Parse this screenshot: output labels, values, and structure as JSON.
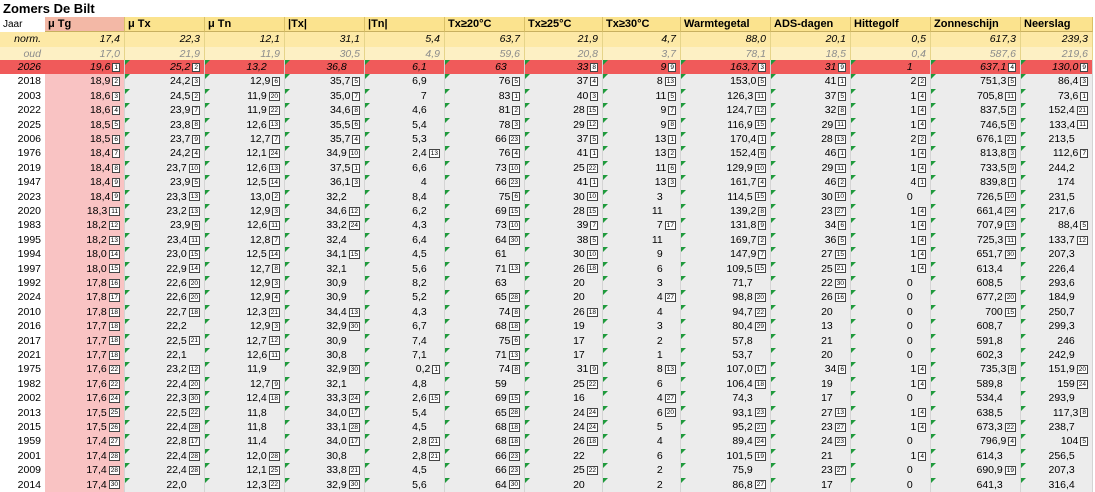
{
  "title": "Zomers De Bilt",
  "colors": {
    "header": "#fbe38e",
    "header_first": "#f3b8a6",
    "norm_row": "#fde9a6",
    "oud_row": "#fdf0c4",
    "current_row": "#f05a5a",
    "tg_column": "#f9c3c3",
    "body_band": "#ececec",
    "marker": "#1f9a3c"
  },
  "columns": [
    "Jaar",
    "μ Tg",
    "μ Tx",
    "μ Tn",
    "|Tx|",
    "|Tn|",
    "Tx≥20°C",
    "Tx≥25°C",
    "Tx≥30°C",
    "Warmtegetal",
    "ADS-dagen",
    "Hittegolf",
    "Zonneschijn",
    "Neerslag"
  ],
  "norm": {
    "label": "norm.",
    "values": [
      "17,4",
      "22,3",
      "12,1",
      "31,1",
      "5,4",
      "63,7",
      "21,9",
      "4,7",
      "88,0",
      "20,1",
      "0,5",
      "617,3",
      "239,3"
    ]
  },
  "oud": {
    "label": "oud",
    "values": [
      "17,0",
      "21,9",
      "11,9",
      "30,5",
      "4,9",
      "59,6",
      "20,8",
      "3,7",
      "78,1",
      "18,5",
      "0,4",
      "587,6",
      "219,6"
    ]
  },
  "rows": [
    {
      "y": "2026",
      "v": [
        "19,6",
        "25,2",
        "13,2",
        "36,8",
        "6,1",
        "63",
        "33",
        "9",
        "163,7",
        "31",
        "1",
        "637,1",
        "130,0"
      ],
      "r": [
        "1",
        "2",
        "",
        "",
        "",
        "",
        "8",
        "9",
        "3",
        "9",
        "",
        "4",
        "9"
      ]
    },
    {
      "y": "2018",
      "v": [
        "18,9",
        "24,2",
        "12,9",
        "35,7",
        "6,9",
        "76",
        "37",
        "8",
        "153,0",
        "41",
        "2",
        "751,3",
        "86,4"
      ],
      "r": [
        "2",
        "3",
        "6",
        "5",
        "",
        "5",
        "4",
        "13",
        "5",
        "1",
        "2",
        "5",
        "3"
      ]
    },
    {
      "y": "2003",
      "v": [
        "18,6",
        "24,5",
        "11,9",
        "35,0",
        "7",
        "83",
        "40",
        "11",
        "126,3",
        "37",
        "1",
        "705,8",
        "73,6"
      ],
      "r": [
        "3",
        "2",
        "20",
        "7",
        "",
        "1",
        "3",
        "5",
        "11",
        "5",
        "4",
        "11",
        "1"
      ]
    },
    {
      "y": "2022",
      "v": [
        "18,6",
        "23,9",
        "11,9",
        "34,6",
        "4,6",
        "81",
        "28",
        "9",
        "124,7",
        "32",
        "1",
        "837,5",
        "152,4"
      ],
      "r": [
        "4",
        "7",
        "22",
        "8",
        "",
        "2",
        "15",
        "7",
        "12",
        "8",
        "4",
        "2",
        "21"
      ]
    },
    {
      "y": "2025",
      "v": [
        "18,5",
        "23,8",
        "12,6",
        "35,5",
        "5,4",
        "78",
        "29",
        "9",
        "116,9",
        "29",
        "1",
        "746,5",
        "133,4"
      ],
      "r": [
        "5",
        "8",
        "13",
        "6",
        "",
        "3",
        "12",
        "8",
        "15",
        "11",
        "4",
        "6",
        "11"
      ]
    },
    {
      "y": "2006",
      "v": [
        "18,5",
        "23,7",
        "12,7",
        "35,7",
        "5,3",
        "66",
        "37",
        "13",
        "170,4",
        "28",
        "2",
        "676,1",
        "213,5"
      ],
      "r": [
        "6",
        "9",
        "7",
        "4",
        "",
        "23",
        "5",
        "1",
        "1",
        "13",
        "2",
        "21",
        ""
      ]
    },
    {
      "y": "1976",
      "v": [
        "18,4",
        "24,2",
        "12,1",
        "34,9",
        "2,4",
        "76",
        "41",
        "13",
        "152,4",
        "46",
        "1",
        "813,8",
        "112,6"
      ],
      "r": [
        "7",
        "4",
        "24",
        "10",
        "13",
        "4",
        "1",
        "2",
        "6",
        "1",
        "4",
        "3",
        "7"
      ]
    },
    {
      "y": "2019",
      "v": [
        "18,4",
        "23,7",
        "12,6",
        "37,5",
        "6,6",
        "73",
        "25",
        "11",
        "129,9",
        "29",
        "1",
        "733,5",
        "244,2"
      ],
      "r": [
        "8",
        "10",
        "13",
        "1",
        "",
        "10",
        "22",
        "6",
        "10",
        "11",
        "4",
        "9",
        ""
      ]
    },
    {
      "y": "1947",
      "v": [
        "18,4",
        "23,9",
        "12,5",
        "36,1",
        "4",
        "66",
        "41",
        "13",
        "161,7",
        "46",
        "4",
        "839,8",
        "174"
      ],
      "r": [
        "9",
        "5",
        "14",
        "3",
        "",
        "23",
        "1",
        "3",
        "4",
        "2",
        "1",
        "1",
        ""
      ]
    },
    {
      "y": "2023",
      "v": [
        "18,4",
        "23,3",
        "13,0",
        "32,2",
        "8,4",
        "75",
        "30",
        "3",
        "114,5",
        "30",
        "0",
        "726,5",
        "231,5"
      ],
      "r": [
        "9",
        "13",
        "2",
        "",
        "",
        "6",
        "10",
        "",
        "15",
        "10",
        "",
        "10",
        ""
      ]
    },
    {
      "y": "2020",
      "v": [
        "18,3",
        "23,2",
        "12,9",
        "34,6",
        "6,2",
        "69",
        "28",
        "11",
        "139,2",
        "23",
        "1",
        "661,4",
        "217,6"
      ],
      "r": [
        "11",
        "13",
        "3",
        "12",
        "",
        "15",
        "15",
        "",
        "8",
        "27",
        "4",
        "24",
        ""
      ]
    },
    {
      "y": "1983",
      "v": [
        "18,2",
        "23,9",
        "12,6",
        "33,2",
        "4,3",
        "73",
        "39",
        "7",
        "131,8",
        "34",
        "1",
        "707,9",
        "88,4"
      ],
      "r": [
        "12",
        "6",
        "11",
        "24",
        "",
        "10",
        "7",
        "17",
        "9",
        "6",
        "4",
        "13",
        "5"
      ]
    },
    {
      "y": "1995",
      "v": [
        "18,2",
        "23,4",
        "12,8",
        "32,4",
        "6,4",
        "64",
        "38",
        "11",
        "169,7",
        "36",
        "1",
        "725,3",
        "133,7"
      ],
      "r": [
        "13",
        "11",
        "7",
        "",
        "",
        "30",
        "5",
        "",
        "2",
        "5",
        "4",
        "11",
        "12"
      ]
    },
    {
      "y": "1994",
      "v": [
        "18,0",
        "23,0",
        "12,5",
        "34,1",
        "4,5",
        "61",
        "30",
        "9",
        "147,9",
        "27",
        "1",
        "651,7",
        "207,3"
      ],
      "r": [
        "14",
        "15",
        "14",
        "15",
        "",
        "",
        "10",
        "",
        "7",
        "15",
        "4",
        "30",
        ""
      ]
    },
    {
      "y": "1997",
      "v": [
        "18,0",
        "22,9",
        "12,7",
        "32,1",
        "5,6",
        "71",
        "26",
        "6",
        "109,5",
        "25",
        "1",
        "613,4",
        "226,4"
      ],
      "r": [
        "15",
        "14",
        "8",
        "",
        "",
        "13",
        "18",
        "",
        "15",
        "21",
        "4",
        "",
        ""
      ]
    },
    {
      "y": "1992",
      "v": [
        "17,8",
        "22,6",
        "12,9",
        "30,9",
        "8,2",
        "63",
        "20",
        "3",
        "71,7",
        "22",
        "0",
        "608,5",
        "293,6"
      ],
      "r": [
        "16",
        "20",
        "3",
        "",
        "",
        "",
        "",
        "",
        "",
        "30",
        "",
        "",
        ""
      ]
    },
    {
      "y": "2024",
      "v": [
        "17,8",
        "22,6",
        "12,9",
        "30,9",
        "5,2",
        "65",
        "20",
        "4",
        "98,8",
        "26",
        "0",
        "677,2",
        "184,9"
      ],
      "r": [
        "17",
        "20",
        "4",
        "",
        "",
        "28",
        "",
        "27",
        "20",
        "16",
        "",
        "20",
        ""
      ]
    },
    {
      "y": "2010",
      "v": [
        "17,8",
        "22,7",
        "12,3",
        "34,4",
        "4,3",
        "74",
        "26",
        "4",
        "94,7",
        "20",
        "0",
        "700",
        "250,7"
      ],
      "r": [
        "18",
        "18",
        "21",
        "13",
        "",
        "8",
        "18",
        "",
        "22",
        "",
        "",
        "15",
        ""
      ]
    },
    {
      "y": "2016",
      "v": [
        "17,7",
        "22,2",
        "12,9",
        "32,9",
        "6,7",
        "68",
        "19",
        "3",
        "80,4",
        "13",
        "0",
        "608,7",
        "299,3"
      ],
      "r": [
        "18",
        "",
        "3",
        "30",
        "",
        "18",
        "",
        "",
        "29",
        "",
        "",
        "",
        ""
      ]
    },
    {
      "y": "2017",
      "v": [
        "17,7",
        "22,5",
        "12,7",
        "30,9",
        "7,4",
        "75",
        "17",
        "2",
        "57,8",
        "21",
        "0",
        "591,8",
        "246"
      ],
      "r": [
        "18",
        "21",
        "12",
        "",
        "",
        "6",
        "",
        "",
        "",
        "",
        "",
        "",
        ""
      ]
    },
    {
      "y": "2021",
      "v": [
        "17,7",
        "22,1",
        "12,6",
        "30,8",
        "7,1",
        "71",
        "17",
        "1",
        "53,7",
        "20",
        "0",
        "602,3",
        "242,9"
      ],
      "r": [
        "18",
        "",
        "11",
        "",
        "",
        "13",
        "",
        "",
        "",
        "",
        "",
        "",
        ""
      ]
    },
    {
      "y": "1975",
      "v": [
        "17,6",
        "23,2",
        "11,9",
        "32,9",
        "0,2",
        "74",
        "31",
        "8",
        "107,0",
        "34",
        "1",
        "735,3",
        "151,9"
      ],
      "r": [
        "22",
        "12",
        "",
        "30",
        "1",
        "8",
        "9",
        "13",
        "17",
        "6",
        "4",
        "8",
        "20"
      ]
    },
    {
      "y": "1982",
      "v": [
        "17,6",
        "22,4",
        "12,7",
        "32,1",
        "4,8",
        "59",
        "25",
        "6",
        "106,4",
        "19",
        "1",
        "589,8",
        "159"
      ],
      "r": [
        "22",
        "20",
        "9",
        "",
        "",
        "",
        "22",
        "",
        "18",
        "",
        "4",
        "",
        "24"
      ]
    },
    {
      "y": "2002",
      "v": [
        "17,6",
        "22,3",
        "12,4",
        "33,3",
        "2,6",
        "69",
        "16",
        "4",
        "74,3",
        "17",
        "0",
        "534,4",
        "293,9"
      ],
      "r": [
        "24",
        "30",
        "18",
        "24",
        "15",
        "15",
        "",
        "27",
        "",
        "",
        "",
        "",
        ""
      ]
    },
    {
      "y": "2013",
      "v": [
        "17,5",
        "22,5",
        "11,8",
        "34,0",
        "5,4",
        "65",
        "24",
        "6",
        "93,1",
        "27",
        "1",
        "638,5",
        "117,3"
      ],
      "r": [
        "25",
        "22",
        "",
        "17",
        "",
        "28",
        "24",
        "20",
        "23",
        "13",
        "4",
        "",
        "8"
      ]
    },
    {
      "y": "2015",
      "v": [
        "17,5",
        "22,4",
        "11,8",
        "33,1",
        "4,5",
        "68",
        "24",
        "5",
        "95,2",
        "23",
        "1",
        "673,3",
        "238,7"
      ],
      "r": [
        "26",
        "28",
        "",
        "28",
        "",
        "18",
        "24",
        "",
        "21",
        "27",
        "4",
        "22",
        ""
      ]
    },
    {
      "y": "1959",
      "v": [
        "17,4",
        "22,8",
        "11,4",
        "34,0",
        "2,8",
        "68",
        "26",
        "4",
        "89,4",
        "24",
        "0",
        "796,9",
        "104"
      ],
      "r": [
        "27",
        "17",
        "",
        "17",
        "21",
        "18",
        "18",
        "",
        "24",
        "23",
        "",
        "4",
        "5"
      ]
    },
    {
      "y": "2001",
      "v": [
        "17,4",
        "22,4",
        "12,0",
        "30,8",
        "2,8",
        "66",
        "22",
        "6",
        "101,5",
        "21",
        "1",
        "614,3",
        "256,5"
      ],
      "r": [
        "28",
        "28",
        "28",
        "",
        "21",
        "23",
        "",
        "",
        "19",
        "",
        "4",
        "",
        ""
      ]
    },
    {
      "y": "2009",
      "v": [
        "17,4",
        "22,4",
        "12,1",
        "33,8",
        "4,5",
        "66",
        "25",
        "2",
        "75,9",
        "23",
        "0",
        "690,9",
        "207,3"
      ],
      "r": [
        "28",
        "28",
        "25",
        "21",
        "",
        "23",
        "22",
        "",
        "",
        "27",
        "",
        "19",
        ""
      ]
    },
    {
      "y": "2014",
      "v": [
        "17,4",
        "22,0",
        "12,3",
        "32,9",
        "5,6",
        "64",
        "20",
        "2",
        "86,8",
        "17",
        "0",
        "641,3",
        "316,4"
      ],
      "r": [
        "30",
        "",
        "22",
        "30",
        "",
        "30",
        "",
        "",
        "27",
        "",
        "",
        "",
        ""
      ]
    }
  ]
}
